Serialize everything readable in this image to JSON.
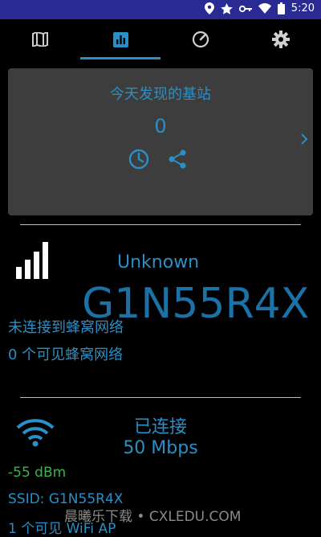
{
  "status_bar": {
    "time": "5:20",
    "icons": [
      "location-icon",
      "star-icon",
      "key-icon",
      "wifi-icon",
      "battery-icon"
    ]
  },
  "tabs": [
    {
      "name": "map",
      "icon": "map-icon"
    },
    {
      "name": "stats",
      "icon": "bar-chart-icon",
      "active": true
    },
    {
      "name": "speed",
      "icon": "speedometer-icon"
    },
    {
      "name": "settings",
      "icon": "gear-icon"
    }
  ],
  "card": {
    "title": "今天发现的基站",
    "count": "0"
  },
  "cell": {
    "network_type": "Unknown",
    "operator": "G1N55R4X",
    "status": "未连接到蜂窝网络",
    "visible": "0 个可见蜂窝网络"
  },
  "wifi": {
    "status": "已连接",
    "speed": "50 Mbps",
    "dbm": "-55 dBm",
    "ssid": "SSID: G1N55R4X",
    "ap_count": "1 个可见 WiFi AP"
  },
  "watermark": "晨曦乐下载 • CXLEDU.COM",
  "colors": {
    "accent": "#2a8fc7",
    "green": "#39b54a",
    "statusbar": "#2a2a94",
    "card": "#3d3d3d"
  }
}
